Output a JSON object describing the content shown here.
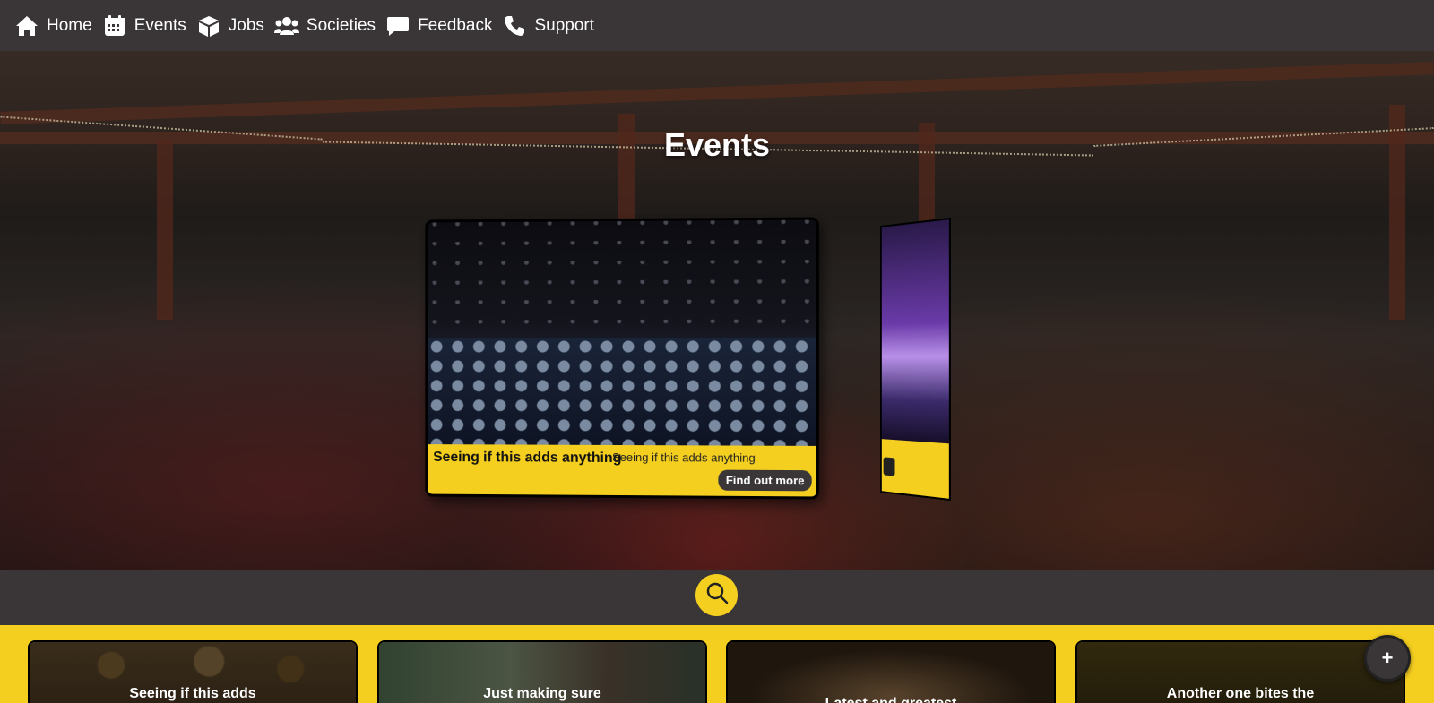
{
  "nav": {
    "items": [
      {
        "label": "Home",
        "icon": "home-icon"
      },
      {
        "label": "Events",
        "icon": "calendar-icon"
      },
      {
        "label": "Jobs",
        "icon": "box-icon"
      },
      {
        "label": "Societies",
        "icon": "users-icon"
      },
      {
        "label": "Feedback",
        "icon": "chat-icon"
      },
      {
        "label": "Support",
        "icon": "phone-icon"
      }
    ]
  },
  "hero": {
    "title": "Events",
    "featured": {
      "title": "Seeing if this adds anything",
      "description": "Seeing if this adds anything",
      "button": "Find out more"
    }
  },
  "search": {
    "icon": "search-icon"
  },
  "events": [
    {
      "title": "Seeing if this adds"
    },
    {
      "title": "Just making sure"
    },
    {
      "title": "Latest and greatest"
    },
    {
      "title": "Another one bites the"
    }
  ],
  "fab": {
    "label": "+"
  },
  "colors": {
    "accent": "#f5cf1f",
    "dark": "#3a3638"
  }
}
